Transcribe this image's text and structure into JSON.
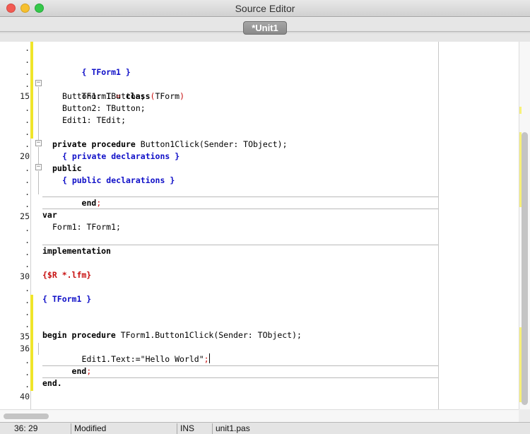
{
  "window": {
    "title": "Source Editor"
  },
  "tabs": [
    {
      "label": "*Unit1"
    }
  ],
  "gutter": {
    "line_markers": [
      ".",
      ".",
      ".",
      ".",
      "15",
      ".",
      ".",
      ".",
      ".",
      "20",
      ".",
      ".",
      ".",
      ".",
      "25",
      ".",
      ".",
      ".",
      ".",
      "30",
      ".",
      ".",
      ".",
      ".",
      "35",
      "36",
      ".",
      ".",
      ".",
      "40"
    ]
  },
  "code": {
    "l1": "{ TForm1 }",
    "l3a": "TForm1",
    "l3b": " = ",
    "l3c": "class",
    "l3d": "(",
    "l3e": "TForm",
    "l3f": ")",
    "l4": "Button1: TButton;",
    "l5": "Button2: TButton;",
    "l6": "Edit1: TEdit;",
    "l7a": "procedure",
    "l7b": " Button1Click(Sender: TObject);",
    "l8": "private",
    "l9": "{ private declarations }",
    "l10": "public",
    "l11": "{ public declarations }",
    "l12a": "end",
    "l12b": ";",
    "l14": "var",
    "l15": "Form1: TForm1;",
    "l17": "implementation",
    "l19": "{$R *.lfm}",
    "l21": "{ TForm1 }",
    "l23a": "procedure",
    "l23b": " TForm1.Button1Click(Sender: TObject);",
    "l24": "begin",
    "l25a": "Edit1.Text:=",
    "l25b": "\"Hello World\"",
    "l25c": ";",
    "l26a": "end",
    "l26b": ";",
    "l28": "end."
  },
  "status": {
    "position": "36: 29",
    "modified": "Modified",
    "mode": "INS",
    "filename": "unit1.pas"
  },
  "colors": {
    "keyword": "#000000",
    "comment": "#1010c8",
    "directive": "#c81010",
    "symbol": "#c81010",
    "modified_marker": "#f0e52a"
  }
}
